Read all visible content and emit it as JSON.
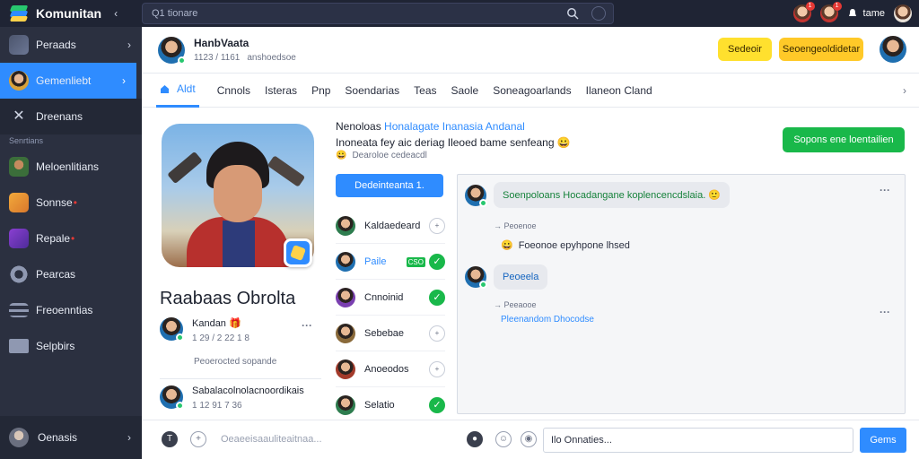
{
  "app": {
    "name": "Komunitan",
    "collapse_glyph": "‹"
  },
  "search": {
    "value": "Q1 tionare"
  },
  "topbar": {
    "user_label": "tame",
    "notif_count_1": "1",
    "notif_count_2": "1"
  },
  "sidebar": {
    "items": [
      {
        "label": "Peraads",
        "icon": "layers-icon"
      },
      {
        "label": "Gemenliebt",
        "icon": "avatar-icon"
      },
      {
        "label": "Dreenans",
        "icon": "crossed-swords-icon"
      }
    ],
    "section_label": "Senrtians",
    "sub_items": [
      {
        "label": "Meloenlitians",
        "icon": "character-icon"
      },
      {
        "label": "Sonnse",
        "icon": "game-icon",
        "mark": "•"
      },
      {
        "label": "Repale",
        "icon": "gem-icon",
        "mark": "•"
      },
      {
        "label": "Pearcas",
        "icon": "gear-icon"
      },
      {
        "label": "Freoenntias",
        "icon": "list-icon"
      },
      {
        "label": "Selpbirs",
        "icon": "folder-icon"
      }
    ],
    "bottom_label": "Oenasis"
  },
  "profile": {
    "name": "HanbVaata",
    "stats": "1123 / 1161",
    "handle": "anshoedsoe",
    "button_1": "Sedeoir",
    "button_2": "Seoengeoldidetar"
  },
  "tabs": [
    {
      "label": "Aldt"
    },
    {
      "label": "Cnnols"
    },
    {
      "label": "Isteras"
    },
    {
      "label": "Pnp"
    },
    {
      "label": "Soendarias"
    },
    {
      "label": "Teas"
    },
    {
      "label": "Saole"
    },
    {
      "label": "Soneagoarlands"
    },
    {
      "label": "Ilaneon Cland"
    }
  ],
  "hero": {
    "display_name": "Raabaas Obrolta"
  },
  "mini_users": [
    {
      "name": "Kandan",
      "emoji": "🎁",
      "stats": "1 29 / 2 22 1 8"
    },
    {
      "name": "Sabalacolnolacnoordikais",
      "emoji": "",
      "stats": "1 12 91 7 36"
    }
  ],
  "report_link": "Peoerocted sopande",
  "description": {
    "title_plain": "Nenoloas ",
    "title_accent": "Honalagate Inanasia Andanal",
    "subtitle": "Inoneata fey aic deriag Ileoed bame senfeang",
    "subtitle_emoji": "😀",
    "meta_emoji": "😀",
    "meta": "Dearoloe cedeacdl"
  },
  "primary_button": "Dedeinteanta 1.",
  "green_button": "Sopons ene loentailien",
  "members": [
    {
      "label": "Kaldaedeard",
      "state": "pending",
      "state_glyph": "+"
    },
    {
      "label": "Paile",
      "state": "check",
      "tag": "CSO",
      "state_glyph": "✓"
    },
    {
      "label": "Cnnoinid",
      "state": "check",
      "state_glyph": "✓"
    },
    {
      "label": "Sebebae",
      "state": "pending",
      "state_glyph": "+"
    },
    {
      "label": "Anoeodos",
      "state": "pending",
      "state_glyph": "+"
    },
    {
      "label": "Selatio",
      "state": "check",
      "state_glyph": "✓"
    }
  ],
  "chat": {
    "message_1": "Soenpoloans Hocadangane koplencencdslaia.",
    "message_1_emoji": "🙂",
    "reply_label_1": "Peoenoe",
    "reply_text_1": "Foeonoe epyhpone lhsed",
    "reply_emoji_1": "😀",
    "message_2": "Peoeela",
    "reply_label_2": "Peeaooe",
    "reply_link_2": "Pleenandom Dhocodse",
    "menu_glyph": "···",
    "reply_arrow": "→"
  },
  "composer": {
    "left_icon_glyph": "T",
    "add_glyph": "+",
    "placeholder": "Oeaeeisaauliteaitnaa...",
    "input_value": "Ilo Onnaties...",
    "send_label": "Gems",
    "emoji_glyph": "☺",
    "record_glyph": "●",
    "attach_glyph": "◉"
  },
  "colors": {
    "accent": "#2f8cff",
    "success": "#19b84a",
    "warning": "#ffc928",
    "sidebar_bg": "#2b3040"
  }
}
